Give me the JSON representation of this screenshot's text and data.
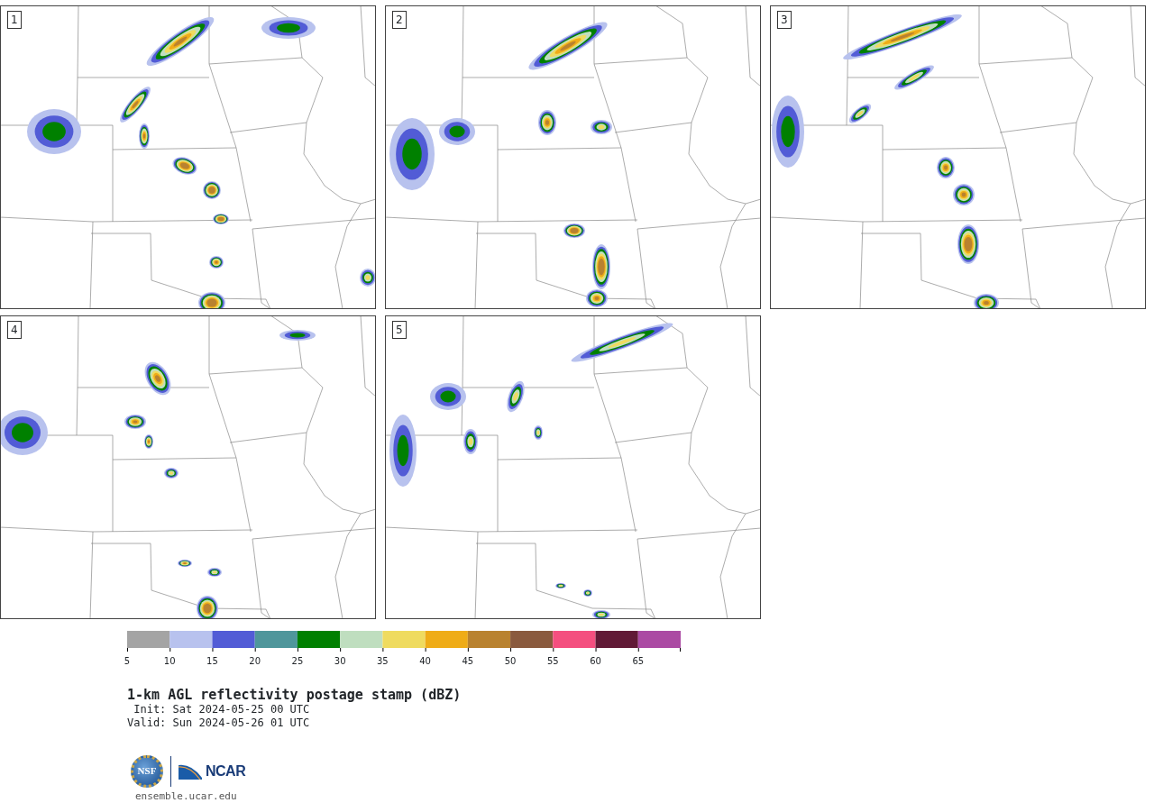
{
  "panels": [
    {
      "label": "1"
    },
    {
      "label": "2"
    },
    {
      "label": "3"
    },
    {
      "label": "4"
    },
    {
      "label": "5"
    }
  ],
  "colorbar": {
    "bins": [
      {
        "label": "5",
        "color": "#a4a4a4"
      },
      {
        "label": "10",
        "color": "#b8c2ee"
      },
      {
        "label": "15",
        "color": "#525cd6"
      },
      {
        "label": "20",
        "color": "#4f969b"
      },
      {
        "label": "25",
        "color": "#008000"
      },
      {
        "label": "30",
        "color": "#bfdebf"
      },
      {
        "label": "35",
        "color": "#efdb5f"
      },
      {
        "label": "40",
        "color": "#efac17"
      },
      {
        "label": "45",
        "color": "#b9822f"
      },
      {
        "label": "50",
        "color": "#8a5a3e"
      },
      {
        "label": "55",
        "color": "#f44f7f"
      },
      {
        "label": "60",
        "color": "#611a36"
      },
      {
        "label": "65",
        "color": "#ab4aa3"
      }
    ]
  },
  "title": "1-km AGL reflectivity postage stamp (dBZ)",
  "init": " Init: Sat 2024-05-25 00 UTC",
  "valid": "Valid: Sun 2024-05-26 01 UTC",
  "logo": {
    "left_text": "NSF",
    "right_text": "NCAR"
  },
  "url": "ensemble.ucar.edu"
}
